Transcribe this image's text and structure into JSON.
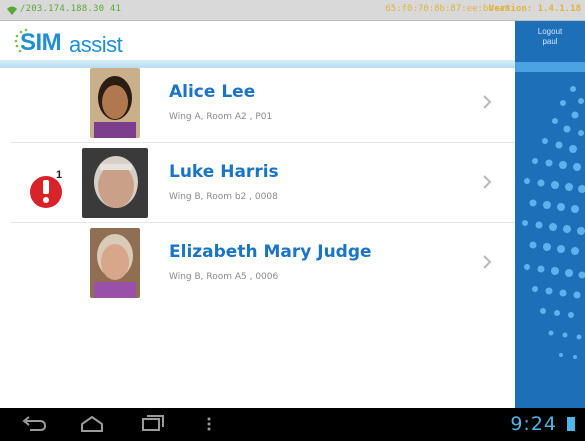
{
  "statusbar": {
    "ip": "/203.174.188.30 41",
    "mac": "65:f0:70:8b:87:ee:bb:a8",
    "version": "Version: 1.4.1.18"
  },
  "header": {
    "logo_main": "SIM",
    "logo_sub": "assist"
  },
  "side": {
    "logout_label": "Logout",
    "user": "paul"
  },
  "residents": [
    {
      "name": "Alice Lee",
      "location": "Wing A, Room A2 , P01",
      "alert_count": ""
    },
    {
      "name": "Luke Harris",
      "location": "Wing B, Room b2 , 0008",
      "alert_count": "1"
    },
    {
      "name": "Elizabeth Mary Judge",
      "location": "Wing B, Room A5 , 0006",
      "alert_count": ""
    }
  ],
  "navbar": {
    "clock": "9:24"
  },
  "colors": {
    "accent": "#1b74c4",
    "alert": "#d8232a",
    "panel": "#1d6fb8"
  }
}
